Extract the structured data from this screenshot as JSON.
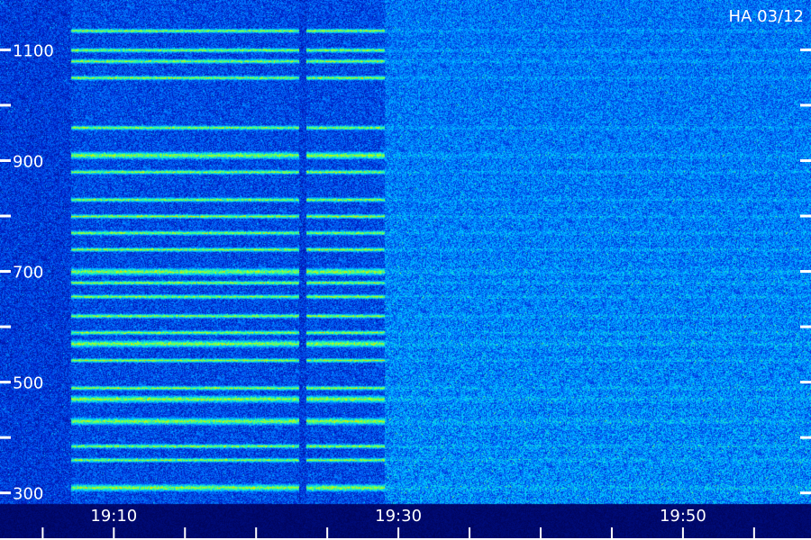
{
  "chart_data": {
    "type": "heatmap",
    "title": "HA 03/12",
    "xlabel": "",
    "ylabel": "",
    "x_ticks": [
      "19:10",
      "19:30",
      "19:50"
    ],
    "y_ticks": [
      "300",
      "500",
      "700",
      "900",
      "1100"
    ],
    "x_range": [
      "19:02",
      "19:59"
    ],
    "y_range": [
      280,
      1190
    ],
    "colormap": [
      "#00004a",
      "#0022cc",
      "#0077ff",
      "#00ccff",
      "#33ff99",
      "#ccff00",
      "#ffaa00"
    ],
    "segments": [
      {
        "start": "19:02",
        "end": "19:07",
        "level": 0.15
      },
      {
        "start": "19:07",
        "end": "19:23",
        "level": 0.85
      },
      {
        "start": "19:23",
        "end": "19:23.5",
        "level": 0.1
      },
      {
        "start": "19:23.5",
        "end": "19:29",
        "level": 0.9
      },
      {
        "start": "19:29",
        "end": "19:59",
        "level": 0.3
      }
    ],
    "bands": [
      310,
      360,
      385,
      430,
      470,
      490,
      540,
      570,
      590,
      620,
      655,
      680,
      700,
      740,
      770,
      800,
      830,
      880,
      910,
      960,
      1050,
      1080,
      1100,
      1135
    ],
    "strong_bands": [
      310,
      430,
      470,
      570,
      700,
      910
    ]
  }
}
